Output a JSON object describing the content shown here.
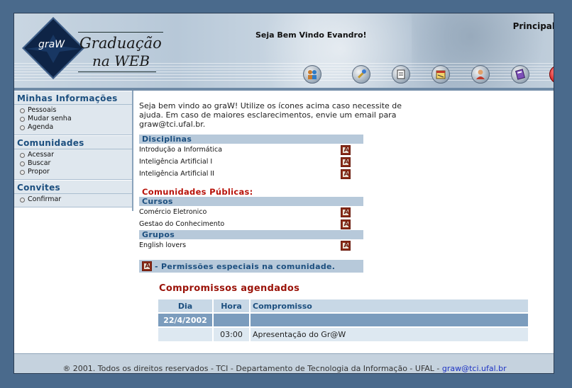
{
  "header": {
    "logo_small": "graW",
    "logo_line1": "Graduação",
    "logo_line2": "na WEB",
    "welcome": "Seja Bem Vindo Evandro!",
    "principal": "Principal",
    "toolbar_icons": [
      "people-icon",
      "tools-icon",
      "document-icon",
      "schedule-icon",
      "user-icon",
      "book-icon",
      "close-icon"
    ]
  },
  "sidebar": {
    "sections": [
      {
        "title": "Minhas Informações",
        "items": [
          "Pessoais",
          "Mudar senha",
          "Agenda"
        ]
      },
      {
        "title": "Comunidades",
        "items": [
          "Acessar",
          "Buscar",
          "Propor"
        ]
      },
      {
        "title": "Convites",
        "items": [
          "Confirmar"
        ]
      }
    ]
  },
  "main": {
    "intro": "Seja bem vindo ao graW! Utilize os ícones acima caso necessite de ajuda. Em caso de maiores esclarecimentos, envie um email para graw@tci.ufal.br.",
    "disciplinas_title": "Disciplinas",
    "disciplinas": [
      "Introdução a Informática",
      "Inteligência Artificial I",
      "Inteligência Artificial II"
    ],
    "comunidades_title": "Comunidades Públicas:",
    "cursos_title": "Cursos",
    "cursos": [
      "Comércio Eletronico",
      "Gestao do Conhecimento"
    ],
    "grupos_title": "Grupos",
    "grupos": [
      "English lovers"
    ],
    "permissoes": "- Permissões especiais na comunidade.",
    "admin_icon_letter": "A"
  },
  "compromissos": {
    "title": "Compromissos agendados",
    "headers": [
      "Dia",
      "Hora",
      "Compromisso"
    ],
    "date": "22/4/2002",
    "entries": [
      {
        "hora": "03:00",
        "compromisso": "Apresentação do Gr@W"
      }
    ]
  },
  "footer": {
    "text": "® 2001. Todos os direitos reservados - TCI - Departamento de Tecnologia da Informação - UFAL - ",
    "email": "graw@tci.ufal.br"
  },
  "colors": {
    "background": "#4a6a8c",
    "accent_blue": "#1c4f7f",
    "accent_red": "#b8130a",
    "section_bar": "#b7c9da"
  }
}
